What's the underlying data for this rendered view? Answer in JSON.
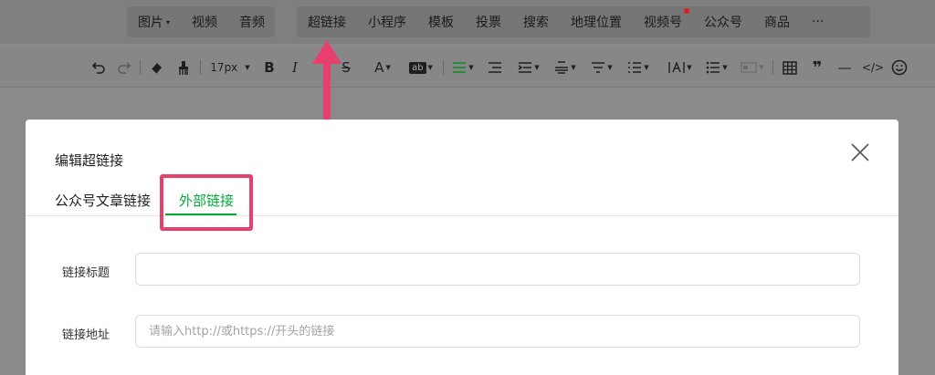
{
  "topbar": {
    "media_items": [
      {
        "label": "图片",
        "has_caret": true
      },
      {
        "label": "视频"
      },
      {
        "label": "音频"
      }
    ],
    "insert_items": [
      {
        "label": "超链接"
      },
      {
        "label": "小程序"
      },
      {
        "label": "模板"
      },
      {
        "label": "投票"
      },
      {
        "label": "搜索"
      },
      {
        "label": "地理位置"
      },
      {
        "label": "视频号",
        "badge": true
      },
      {
        "label": "公众号"
      },
      {
        "label": "商品"
      },
      {
        "label": "···"
      }
    ]
  },
  "toolbar": {
    "font_size": "17px",
    "bold": "B",
    "italic": "I",
    "strike": "S",
    "font_color": "A",
    "bg_color": "ab",
    "quote": "❞",
    "divider": "—",
    "code": "</>"
  },
  "dialog": {
    "title": "编辑超链接",
    "tabs": [
      "公众号文章链接",
      "外部链接"
    ],
    "active_tab": 1,
    "fields": {
      "title_label": "链接标题",
      "title_value": "",
      "url_label": "链接地址",
      "url_placeholder": "请输入http://或https://开头的链接"
    }
  },
  "colors": {
    "accent": "#07a83a",
    "annotation": "#e8406c"
  }
}
